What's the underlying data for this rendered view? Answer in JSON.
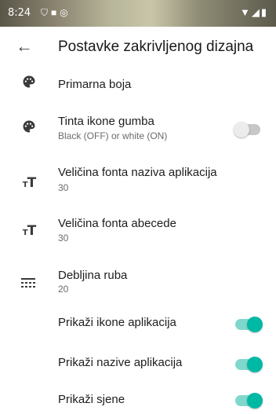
{
  "status_bar": {
    "time": "8:24",
    "left_icons": [
      "vpn-icon",
      "lock-icon",
      "sync-icon"
    ],
    "right_icons": [
      "wifi-icon",
      "signal-icon",
      "battery-icon"
    ]
  },
  "header": {
    "title": "Postavke zakrivljenog dizajna"
  },
  "settings": [
    {
      "label": "Primarna boja",
      "icon": "palette-icon"
    },
    {
      "label": "Tinta ikone gumba",
      "summary": "Black (OFF) or white (ON)",
      "icon": "palette-icon",
      "toggle": false
    },
    {
      "label": "Veličina fonta naziva aplikacija",
      "summary": "30",
      "icon": "text-size-icon"
    },
    {
      "label": "Veličina fonta abecede",
      "summary": "30",
      "icon": "text-size-icon"
    },
    {
      "label": "Debljina ruba",
      "summary": "20",
      "icon": "border-style-icon"
    },
    {
      "label": "Prikaži ikone aplikacija",
      "toggle": true
    },
    {
      "label": "Prikaži nazive aplikacija",
      "toggle": true
    },
    {
      "label": "Prikaži sjene",
      "toggle": true
    }
  ],
  "colors": {
    "accent": "#00b9a5",
    "accent_track": "#80d8cd",
    "switch_off_track": "#c7c7c7"
  }
}
